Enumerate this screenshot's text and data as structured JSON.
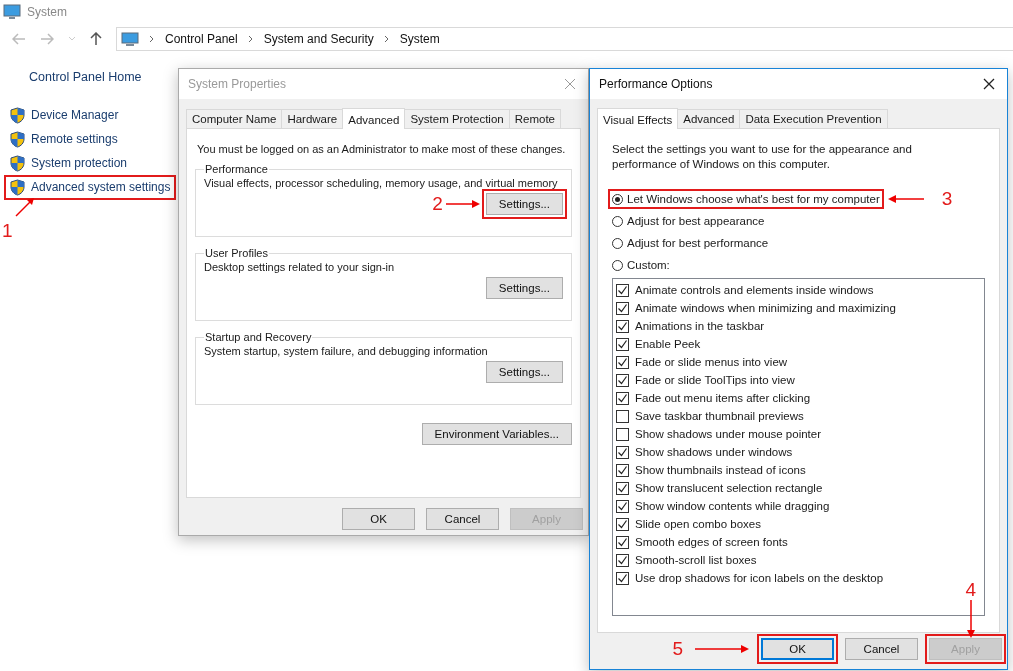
{
  "window": {
    "title": "System"
  },
  "address_bar": {
    "crumbs": [
      "Control Panel",
      "System and Security",
      "System"
    ]
  },
  "sidebar": {
    "home": "Control Panel Home",
    "items": [
      {
        "label": "Device Manager",
        "highlighted": false
      },
      {
        "label": "Remote settings",
        "highlighted": false
      },
      {
        "label": "System protection",
        "highlighted": false
      },
      {
        "label": "Advanced system settings",
        "highlighted": true,
        "callout": "1"
      }
    ]
  },
  "system_properties": {
    "title": "System Properties",
    "active": false,
    "tabs": [
      {
        "label": "Computer Name",
        "selected": false
      },
      {
        "label": "Hardware",
        "selected": false
      },
      {
        "label": "Advanced",
        "selected": true
      },
      {
        "label": "System Protection",
        "selected": false
      },
      {
        "label": "Remote",
        "selected": false
      }
    ],
    "note": "You must be logged on as an Administrator to make most of these changes.",
    "groups": [
      {
        "title": "Performance",
        "description": "Visual effects, processor scheduling, memory usage, and virtual memory",
        "button": {
          "label": "Settings...",
          "highlighted": true,
          "callout": "2"
        }
      },
      {
        "title": "User Profiles",
        "description": "Desktop settings related to your sign-in",
        "button": {
          "label": "Settings...",
          "highlighted": false
        }
      },
      {
        "title": "Startup and Recovery",
        "description": "System startup, system failure, and debugging information",
        "button": {
          "label": "Settings...",
          "highlighted": false
        }
      }
    ],
    "environment_button": "Environment Variables...",
    "buttons": [
      {
        "label": "OK",
        "disabled": false,
        "focused": false,
        "highlighted": false
      },
      {
        "label": "Cancel",
        "disabled": false,
        "focused": false,
        "highlighted": false
      },
      {
        "label": "Apply",
        "disabled": true,
        "focused": false,
        "highlighted": false
      }
    ]
  },
  "performance_options": {
    "title": "Performance Options",
    "active": true,
    "tabs": [
      {
        "label": "Visual Effects",
        "selected": true
      },
      {
        "label": "Advanced",
        "selected": false
      },
      {
        "label": "Data Execution Prevention",
        "selected": false
      }
    ],
    "intro": "Select the settings you want to use for the appearance and performance of Windows on this computer.",
    "options": [
      {
        "label": "Let Windows choose what's best for my computer",
        "selected": true,
        "highlighted": true,
        "callout": "3"
      },
      {
        "label": "Adjust for best appearance",
        "selected": false,
        "highlighted": false
      },
      {
        "label": "Adjust for best performance",
        "selected": false,
        "highlighted": false
      },
      {
        "label": "Custom:",
        "selected": false,
        "highlighted": false
      }
    ],
    "effects": [
      {
        "label": "Animate controls and elements inside windows",
        "checked": true
      },
      {
        "label": "Animate windows when minimizing and maximizing",
        "checked": true
      },
      {
        "label": "Animations in the taskbar",
        "checked": true
      },
      {
        "label": "Enable Peek",
        "checked": true
      },
      {
        "label": "Fade or slide menus into view",
        "checked": true
      },
      {
        "label": "Fade or slide ToolTips into view",
        "checked": true
      },
      {
        "label": "Fade out menu items after clicking",
        "checked": true
      },
      {
        "label": "Save taskbar thumbnail previews",
        "checked": false
      },
      {
        "label": "Show shadows under mouse pointer",
        "checked": false
      },
      {
        "label": "Show shadows under windows",
        "checked": true
      },
      {
        "label": "Show thumbnails instead of icons",
        "checked": true
      },
      {
        "label": "Show translucent selection rectangle",
        "checked": true
      },
      {
        "label": "Show window contents while dragging",
        "checked": true
      },
      {
        "label": "Slide open combo boxes",
        "checked": true
      },
      {
        "label": "Smooth edges of screen fonts",
        "checked": true
      },
      {
        "label": "Smooth-scroll list boxes",
        "checked": true
      },
      {
        "label": "Use drop shadows for icon labels on the desktop",
        "checked": true
      }
    ],
    "buttons": [
      {
        "label": "OK",
        "disabled": false,
        "focused": true,
        "highlighted": true,
        "callout": {
          "label": "5",
          "kind": "side"
        }
      },
      {
        "label": "Cancel",
        "disabled": false,
        "focused": false,
        "highlighted": false
      },
      {
        "label": "Apply",
        "disabled": true,
        "focused": false,
        "highlighted": true,
        "callout": {
          "label": "4",
          "kind": "top"
        }
      }
    ]
  }
}
